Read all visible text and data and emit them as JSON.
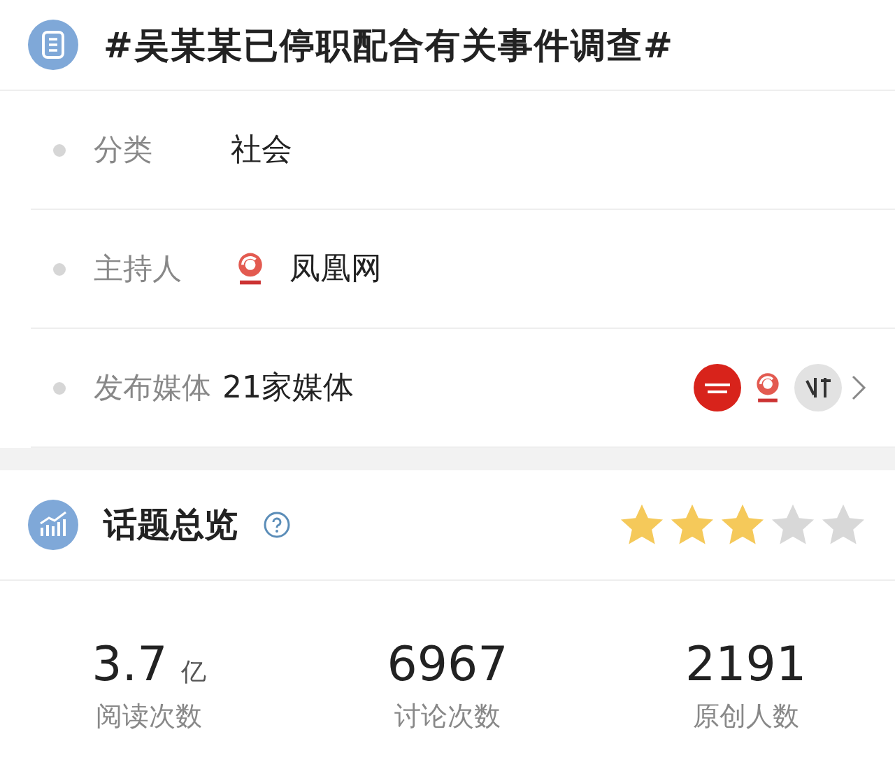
{
  "topic": {
    "title": "#吴某某已停职配合有关事件调查#"
  },
  "info_rows": [
    {
      "kind": "text",
      "label": "分类",
      "value": "社会"
    },
    {
      "kind": "host",
      "label": "主持人",
      "value": "凤凰网"
    },
    {
      "kind": "media",
      "label": "发布媒体",
      "value": "21家媒体"
    }
  ],
  "overview": {
    "title": "话题总览",
    "stars": 3
  },
  "stats": [
    {
      "value": "3.7",
      "unit": "亿",
      "label": "阅读次数"
    },
    {
      "value": "6967",
      "label": "讨论次数"
    },
    {
      "value": "2191",
      "label": "原创人数"
    }
  ]
}
